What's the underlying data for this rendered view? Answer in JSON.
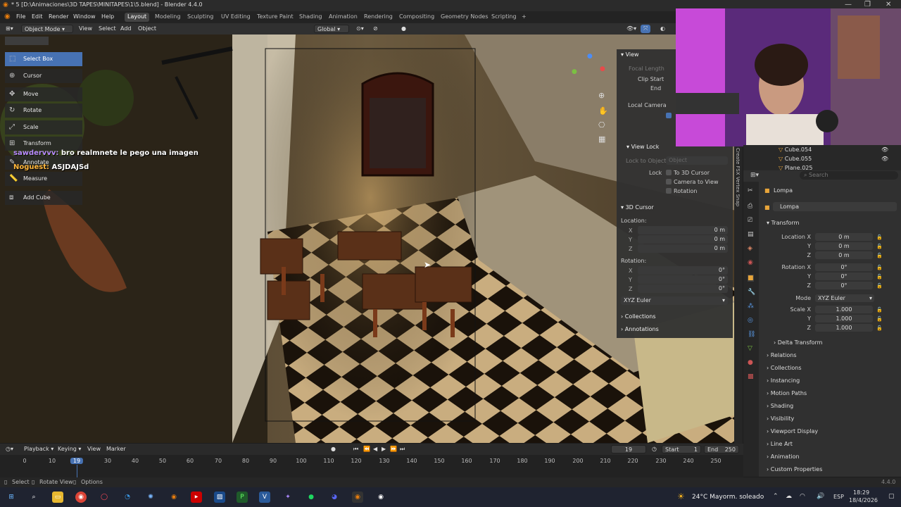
{
  "titlebar": {
    "title": "* 5 [D:\\Animaciones\\3D TAPES\\MINITAPES\\1\\5.blend] - Blender 4.4.0",
    "minimize": "—",
    "maximize": "❐",
    "close": "✕"
  },
  "menu": [
    "File",
    "Edit",
    "Render",
    "Window",
    "Help"
  ],
  "workspaces": [
    "Layout",
    "Modeling",
    "Sculpting",
    "UV Editing",
    "Texture Paint",
    "Shading",
    "Animation",
    "Rendering",
    "Compositing",
    "Geometry Nodes",
    "Scripting",
    "+"
  ],
  "vpheader": {
    "mode": "Object Mode",
    "view": "View",
    "select": "Select",
    "add": "Add",
    "object": "Object",
    "orientation": "Global"
  },
  "tools": [
    "Select Box",
    "Cursor",
    "Move",
    "Rotate",
    "Scale",
    "Transform",
    "Annotate",
    "Measure",
    "Add Cube"
  ],
  "chat": [
    {
      "user": "sawdervvv:",
      "msg": "bro realmnete le pego una imagen"
    },
    {
      "user": "Noguest:",
      "msg": "ASJDAJSd"
    }
  ],
  "npanel": {
    "view": "View",
    "focal": "Focal Length",
    "clip_start": "Clip Start",
    "end": "End",
    "local_camera": "Local Camera",
    "view_lock": "View Lock",
    "lock_to_object": "Lock to Object",
    "object_ph": "Object",
    "lock": "Lock",
    "to_cursor": "To 3D Cursor",
    "camera_to_view": "Camera to View",
    "rotation_lbl": "Rotation",
    "cursor": "3D Cursor",
    "location": "Location:",
    "rotation": "Rotation:",
    "loc": [
      {
        "axis": "X",
        "val": "0 m"
      },
      {
        "axis": "Y",
        "val": "0 m"
      },
      {
        "axis": "Z",
        "val": "0 m"
      }
    ],
    "rot": [
      {
        "axis": "X",
        "val": "0°"
      },
      {
        "axis": "Y",
        "val": "0°"
      },
      {
        "axis": "Z",
        "val": "0°"
      }
    ],
    "euler": "XYZ Euler",
    "collections": "Collections",
    "annotations": "Annotations"
  },
  "sidetabs": "Create   FSX Vertex Snap",
  "outliner": {
    "items": [
      "Cube.054",
      "Cube.055",
      "Plane.025"
    ]
  },
  "props": {
    "search": "Search",
    "object": "Lompa",
    "name": "Lompa",
    "transform": "Transform",
    "location_label": "Location X",
    "loc": [
      "0 m",
      "0 m",
      "0 m"
    ],
    "rotation_label": "Rotation X",
    "rot": [
      "0°",
      "0°",
      "0°"
    ],
    "mode_label": "Mode",
    "mode": "XYZ Euler",
    "scale_label": "Scale X",
    "scale": [
      "1.000",
      "1.000",
      "1.000"
    ],
    "y": "Y",
    "z": "Z",
    "delta": "Delta Transform",
    "sections": [
      "Relations",
      "Collections",
      "Instancing",
      "Motion Paths",
      "Shading",
      "Visibility",
      "Viewport Display",
      "Line Art",
      "Animation",
      "Custom Properties"
    ]
  },
  "timeline": {
    "playback": "Playback",
    "keying": "Keying",
    "view": "View",
    "marker": "Marker",
    "frame": "19",
    "start_lbl": "Start",
    "start": "1",
    "end_lbl": "End",
    "end": "250",
    "ticks": [
      "0",
      "10",
      "19",
      "30",
      "40",
      "50",
      "60",
      "70",
      "80",
      "90",
      "100",
      "110",
      "120",
      "130",
      "140",
      "150",
      "160",
      "170",
      "180",
      "190",
      "200",
      "210",
      "220",
      "230",
      "240",
      "250"
    ]
  },
  "status": {
    "select": "Select",
    "rotate": "Rotate View",
    "options": "Options",
    "version": "4.4.0"
  },
  "taskbar": {
    "weather": "24°C  Mayorm. soleado",
    "lang": "ESP",
    "time": "18:29",
    "date": "18/4/2026"
  },
  "colors": {
    "accent": "#4772b3",
    "header": "#303030",
    "panel": "#303030"
  }
}
